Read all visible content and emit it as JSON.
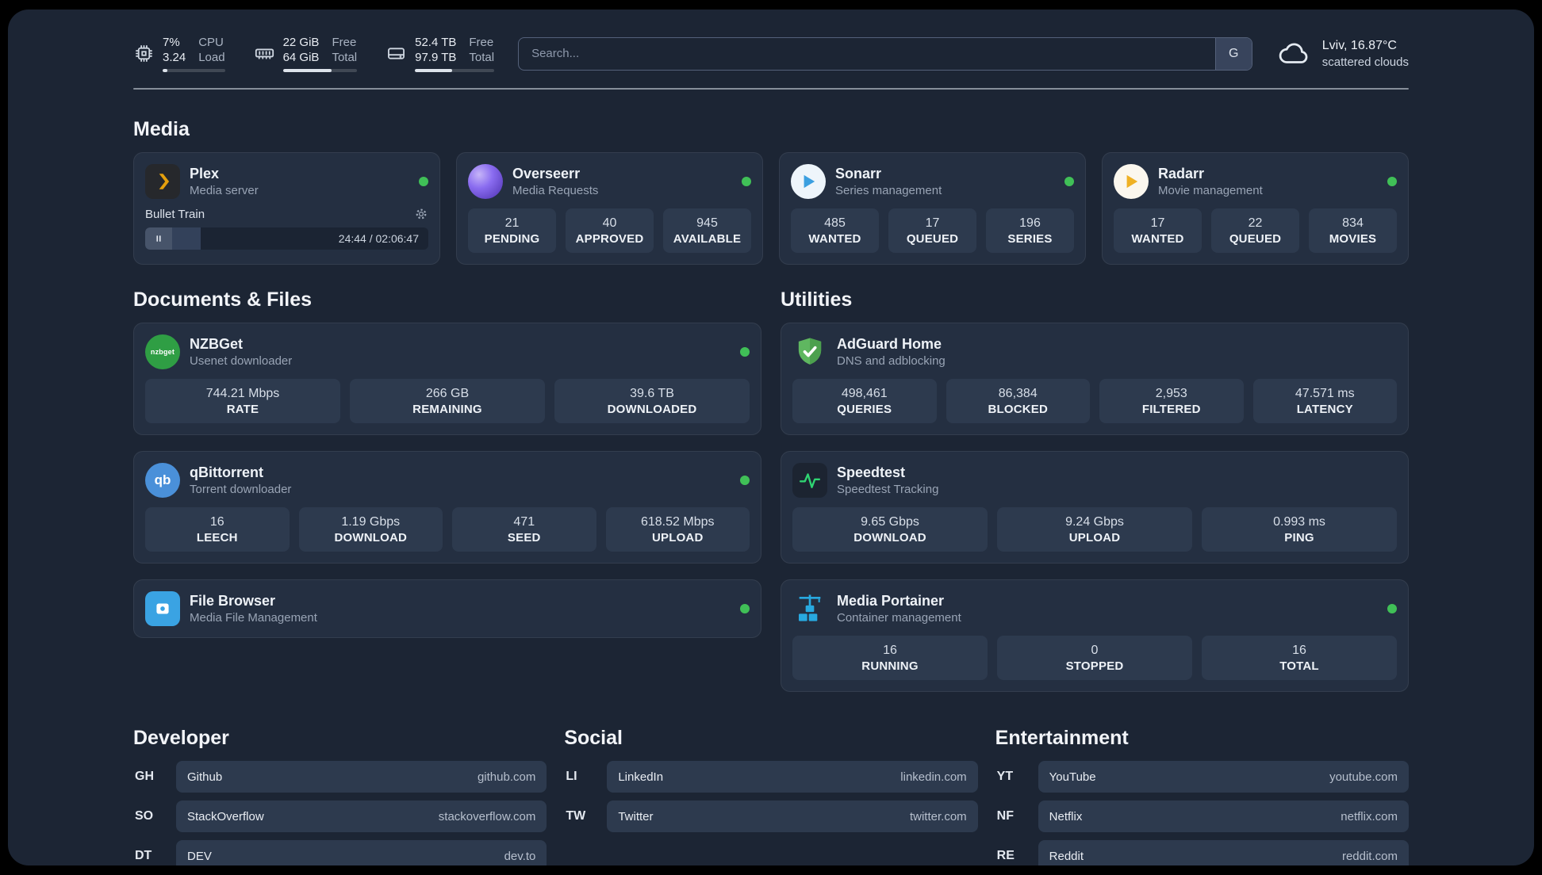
{
  "topbar": {
    "cpu": {
      "icon": "cpu-chip-icon",
      "values": [
        "7%",
        "3.24"
      ],
      "labels": [
        "CPU",
        "Load"
      ],
      "progress_percent": 7
    },
    "memory": {
      "icon": "memory-stick-icon",
      "values": [
        "22 GiB",
        "64 GiB"
      ],
      "labels": [
        "Free",
        "Total"
      ],
      "progress_percent": 66
    },
    "disk": {
      "icon": "hard-drive-icon",
      "values": [
        "52.4 TB",
        "97.9 TB"
      ],
      "labels": [
        "Free",
        "Total"
      ],
      "progress_percent": 47
    },
    "search": {
      "placeholder": "Search...",
      "engine_button": "G"
    },
    "weather": {
      "icon": "cloud-icon",
      "location_temp": "Lviv, 16.87°C",
      "condition": "scattered clouds"
    }
  },
  "sections": {
    "media": "Media",
    "documents": "Documents & Files",
    "utilities": "Utilities",
    "developer": "Developer",
    "social": "Social",
    "entertainment": "Entertainment"
  },
  "apps": {
    "plex": {
      "name": "Plex",
      "subtitle": "Media server",
      "icon": "plex-chevron-icon",
      "status": "online",
      "now_playing": {
        "title": "Bullet Train",
        "time_display": "24:44 / 02:06:47",
        "progress_percent": 19.5
      }
    },
    "overseerr": {
      "name": "Overseerr",
      "subtitle": "Media Requests",
      "icon": "overseerr-swirl-icon",
      "status": "online",
      "stats": [
        {
          "value": "21",
          "label": "PENDING"
        },
        {
          "value": "40",
          "label": "APPROVED"
        },
        {
          "value": "945",
          "label": "AVAILABLE"
        }
      ]
    },
    "sonarr": {
      "name": "Sonarr",
      "subtitle": "Series management",
      "icon": "sonarr-play-icon",
      "status": "online",
      "stats": [
        {
          "value": "485",
          "label": "WANTED"
        },
        {
          "value": "17",
          "label": "QUEUED"
        },
        {
          "value": "196",
          "label": "SERIES"
        }
      ]
    },
    "radarr": {
      "name": "Radarr",
      "subtitle": "Movie management",
      "icon": "radarr-play-icon",
      "status": "online",
      "stats": [
        {
          "value": "17",
          "label": "WANTED"
        },
        {
          "value": "22",
          "label": "QUEUED"
        },
        {
          "value": "834",
          "label": "MOVIES"
        }
      ]
    },
    "nzbget": {
      "name": "NZBGet",
      "subtitle": "Usenet downloader",
      "icon": "nzbget-logo-icon",
      "icon_text": "nzbget",
      "status": "online",
      "stats": [
        {
          "value": "744.21 Mbps",
          "label": "RATE"
        },
        {
          "value": "266 GB",
          "label": "REMAINING"
        },
        {
          "value": "39.6 TB",
          "label": "DOWNLOADED"
        }
      ]
    },
    "qbittorrent": {
      "name": "qBittorrent",
      "subtitle": "Torrent downloader",
      "icon": "qbittorrent-logo-icon",
      "icon_text": "qb",
      "status": "online",
      "stats": [
        {
          "value": "16",
          "label": "LEECH"
        },
        {
          "value": "1.19 Gbps",
          "label": "DOWNLOAD"
        },
        {
          "value": "471",
          "label": "SEED"
        },
        {
          "value": "618.52 Mbps",
          "label": "UPLOAD"
        }
      ]
    },
    "filebrowser": {
      "name": "File Browser",
      "subtitle": "Media File Management",
      "icon": "filebrowser-logo-icon",
      "status": "online"
    },
    "adguard": {
      "name": "AdGuard Home",
      "subtitle": "DNS and adblocking",
      "icon": "adguard-shield-icon",
      "stats": [
        {
          "value": "498,461",
          "label": "QUERIES"
        },
        {
          "value": "86,384",
          "label": "BLOCKED"
        },
        {
          "value": "2,953",
          "label": "FILTERED"
        },
        {
          "value": "47.571 ms",
          "label": "LATENCY"
        }
      ]
    },
    "speedtest": {
      "name": "Speedtest",
      "subtitle": "Speedtest Tracking",
      "icon": "speedtest-pulse-icon",
      "stats": [
        {
          "value": "9.65 Gbps",
          "label": "DOWNLOAD"
        },
        {
          "value": "9.24 Gbps",
          "label": "UPLOAD"
        },
        {
          "value": "0.993 ms",
          "label": "PING"
        }
      ]
    },
    "portainer": {
      "name": "Media Portainer",
      "subtitle": "Container management",
      "icon": "portainer-crane-icon",
      "status": "online",
      "stats": [
        {
          "value": "16",
          "label": "RUNNING"
        },
        {
          "value": "0",
          "label": "STOPPED"
        },
        {
          "value": "16",
          "label": "TOTAL"
        }
      ]
    }
  },
  "bookmarks": {
    "developer": [
      {
        "abbr": "GH",
        "name": "Github",
        "url": "github.com"
      },
      {
        "abbr": "SO",
        "name": "StackOverflow",
        "url": "stackoverflow.com"
      },
      {
        "abbr": "DT",
        "name": "DEV",
        "url": "dev.to"
      }
    ],
    "social": [
      {
        "abbr": "LI",
        "name": "LinkedIn",
        "url": "linkedin.com"
      },
      {
        "abbr": "TW",
        "name": "Twitter",
        "url": "twitter.com"
      }
    ],
    "entertainment": [
      {
        "abbr": "YT",
        "name": "YouTube",
        "url": "youtube.com"
      },
      {
        "abbr": "NF",
        "name": "Netflix",
        "url": "netflix.com"
      },
      {
        "abbr": "RE",
        "name": "Reddit",
        "url": "reddit.com"
      }
    ]
  },
  "colors": {
    "page_background": "#1c2534",
    "card_background": "#242f41",
    "tile_background": "#2d3a4e",
    "status_online": "#40c057",
    "plex_accent": "#e5a00d",
    "divider": "#dfe5ec"
  }
}
